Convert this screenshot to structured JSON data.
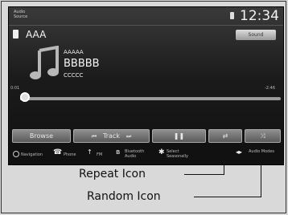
{
  "header": {
    "source_label": "Audio Source",
    "clock": "12:34"
  },
  "device": {
    "name": "AAA",
    "sound_label": "Sound"
  },
  "now_playing": {
    "artist": "AAAAA",
    "album": "BBBBB",
    "title": "CCCCC"
  },
  "progress": {
    "elapsed": "0:01",
    "remaining": "-2:46",
    "fraction": 0.02
  },
  "controls": {
    "browse": "Browse",
    "prev": "⏮",
    "track": "Track",
    "next": "⏭",
    "pause": "❚❚",
    "repeat": "⇄",
    "random": "⤨"
  },
  "bottom_bar": {
    "navigation": "Navigation",
    "phone": "Phone",
    "fm": "FM",
    "bluetooth": "Bluetooth Audio",
    "settings": "Select Seasonally",
    "audio_modes": "Audio Modes"
  },
  "annotations": {
    "repeat": "Repeat Icon",
    "random": "Random Icon"
  }
}
